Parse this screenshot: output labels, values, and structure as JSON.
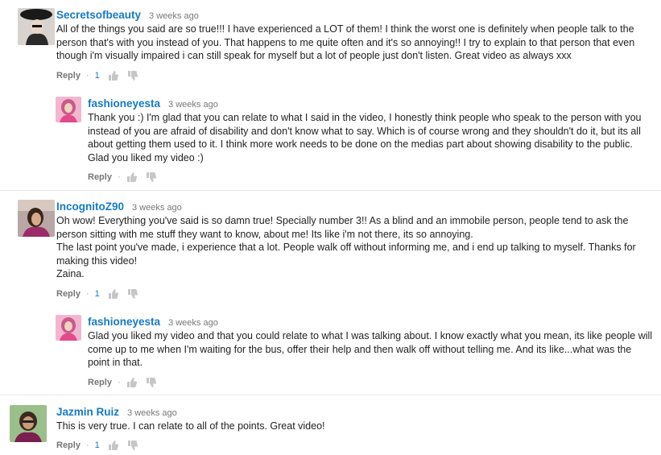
{
  "comments": [
    {
      "author": "Secretsofbeauty",
      "time": "3 weeks ago",
      "paragraphs": [
        "All of the things you said are so true!!! I have experienced a LOT of them! I think the worst one is definitely when people talk to the person that's with you instead of you. That happens to me quite often and it's so annoying!! I try to explain to that person that even though i'm visually impaired i can still speak for myself but a lot of people just don't listen. Great video as always xxx"
      ],
      "reply_label": "Reply",
      "likes": "1"
    },
    {
      "author": "fashioneyesta",
      "time": "3 weeks ago",
      "paragraphs": [
        "Thank you :) I'm glad that you can relate to what I said in the video, I honestly think people who speak to the person with you instead of you are afraid of disability and don't know what to say. Which is of course wrong and they shouldn't do it, but its all about getting them used to it. I think more work needs to be done on the medias part about showing disability to the public. Glad you liked my video :)"
      ],
      "reply_label": "Reply",
      "likes": ""
    },
    {
      "author": "IncognitoZ90",
      "time": "3 weeks ago",
      "paragraphs": [
        "Oh wow! Everything you've said is so damn true! Specially number 3!! As a blind and an immobile person, people tend to ask the person sitting with me stuff they want to know, about me! Its like i'm not there, its so annoying.",
        "The last point you've made, i experience that a lot. People walk off without informing me, and i end up talking to myself. Thanks for making this video!",
        "Zaina."
      ],
      "reply_label": "Reply",
      "likes": "1"
    },
    {
      "author": "fashioneyesta",
      "time": "3 weeks ago",
      "paragraphs": [
        "Glad you liked my video and that you could relate to what I was talking about. I know exactly what you mean, its like people will come up to me when I'm waiting for the bus, offer their help and then walk off without telling me. And its like...what was the point in that."
      ],
      "reply_label": "Reply",
      "likes": ""
    },
    {
      "author": "Jazmin Ruiz",
      "time": "3 weeks ago",
      "paragraphs": [
        "This is very true. I can relate to all of the points. Great video!"
      ],
      "reply_label": "Reply",
      "likes": "1"
    }
  ]
}
